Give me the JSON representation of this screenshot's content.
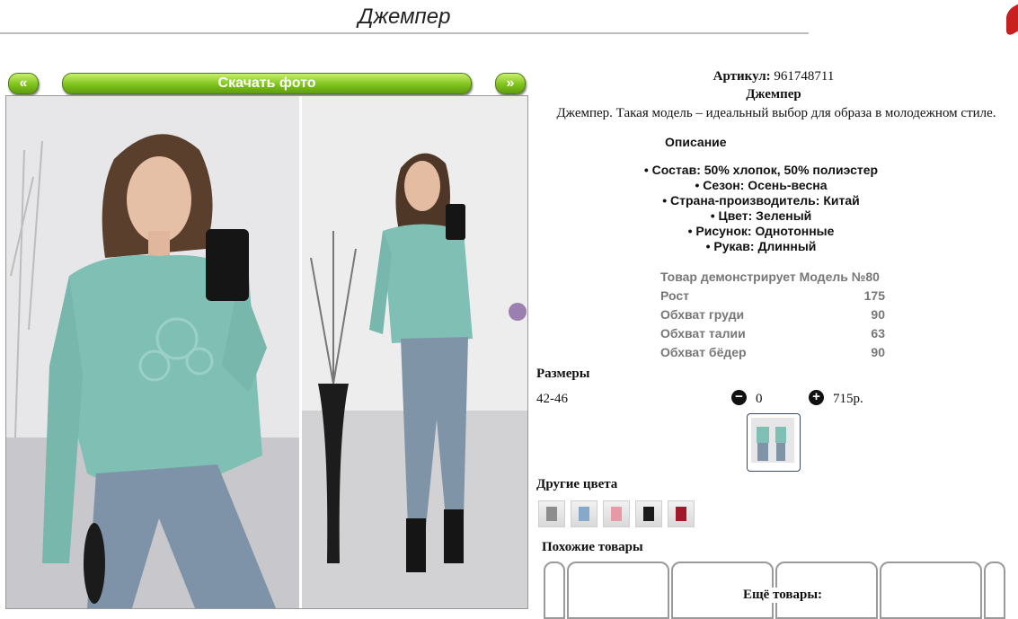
{
  "header": {
    "title": "Джемпер"
  },
  "gallery": {
    "prev_label": "«",
    "next_label": "»",
    "download_label": "Скачать фото"
  },
  "product": {
    "article_label": "Артикул:",
    "article_value": "961748711",
    "name": "Джемпер",
    "summary": "Джемпер. Такая модель – идеальный выбор для образа в молодежном стиле.",
    "description_title": "Описание",
    "features": [
      "• Состав: 50% хлопок, 50% полиэстер",
      "• Сезон: Осень-весна",
      "• Страна-производитель: Китай",
      "• Цвет: Зеленый",
      "• Рисунок: Однотонные",
      "• Рукав: Длинный"
    ],
    "model": {
      "title": "Товар демонстрирует Модель №80",
      "rows": [
        {
          "label": "Рост",
          "value": "175"
        },
        {
          "label": "Обхват груди",
          "value": "90"
        },
        {
          "label": "Обхват талии",
          "value": "63"
        },
        {
          "label": "Обхват бёдер",
          "value": "90"
        }
      ]
    },
    "sizes_title": "Размеры",
    "size": "42-46",
    "quantity": "0",
    "price": "715р.",
    "other_colors_title": "Другие цвета",
    "similar_title": "Похожие товары",
    "more_title": "Ещё товары:"
  },
  "colors": {
    "accent_green": "#7fc31b",
    "sweater_mint": "#7fbfb4",
    "close_red": "#c91f1f"
  }
}
